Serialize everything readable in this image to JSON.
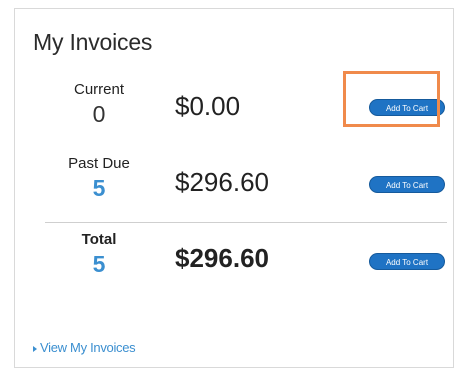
{
  "card": {
    "title": "My Invoices"
  },
  "rows": [
    {
      "label": "Current",
      "count": "0",
      "amount": "$0.00",
      "button": "Add To Cart"
    },
    {
      "label": "Past Due",
      "count": "5",
      "amount": "$296.60",
      "button": "Add To Cart"
    },
    {
      "label": "Total",
      "count": "5",
      "amount": "$296.60",
      "button": "Add To Cart"
    }
  ],
  "footer": {
    "link": "View My Invoices",
    "link_icon": "caret-right-icon"
  },
  "colors": {
    "button_bg": "#1f73c4",
    "link": "#3b8fd0",
    "highlight": "#f08a4b"
  }
}
